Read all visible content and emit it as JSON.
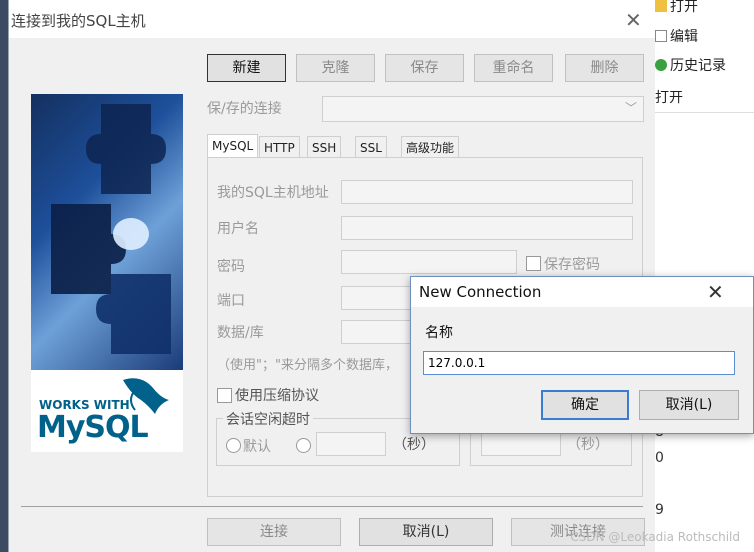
{
  "main_dialog": {
    "title": "连接到我的SQL主机",
    "buttons": {
      "new": "新建",
      "clone": "克隆",
      "save": "保存",
      "rename": "重命名",
      "delete": "删除"
    },
    "saved_connections_label": "保/存的连接",
    "saved_connections_value": "",
    "tabs": [
      "MySQL",
      "HTTP",
      "SSH",
      "SSL",
      "高级功能"
    ],
    "fields": {
      "host_label": "我的SQL主机地址",
      "user_label": "用户名",
      "password_label": "密码",
      "save_password_label": "保存密码",
      "port_label": "端口",
      "database_label": "数据/库",
      "database_hint": "（使用\"；\"来分隔多个数据库，",
      "compression_label": "使用压缩协议",
      "timeout_group_label": "会话空闲超时",
      "default_label": "默认",
      "seconds_label": "（秒）",
      "seconds_label_2": "（秒）"
    },
    "bottom_buttons": {
      "connect": "连接",
      "cancel": "取消(L)",
      "test": "测试连接"
    }
  },
  "logo": {
    "works_with": "WORKS WITH",
    "mysql": "MySQL"
  },
  "popup": {
    "title": "New Connection",
    "name_label": "名称",
    "name_value": "127.0.0.1",
    "ok_label": "确定",
    "cancel_label": "取消(L)"
  },
  "background_app": {
    "open_label": "打开",
    "edit_label": "编辑",
    "history_label": "历史记录",
    "open2_label": "打开",
    "numbers": [
      "8",
      "0",
      "9"
    ]
  },
  "watermark": "CSDN @Leokadia Rothschild",
  "colors": {
    "dialog_bg": "#f0f0f0",
    "accent": "#3b7bd1",
    "mysql_blue": "#00618a",
    "mysql_orange": "#e48e00"
  }
}
